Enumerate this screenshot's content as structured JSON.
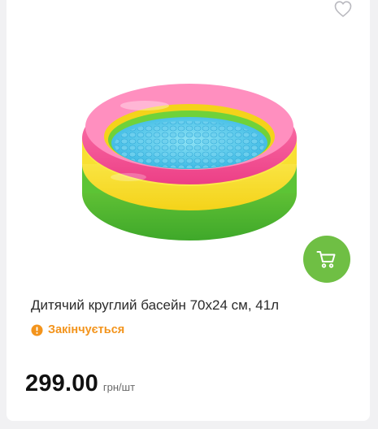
{
  "product": {
    "title": "Дитячий круглий басейн 70х24 см, 41л",
    "stock_status": "Закінчується",
    "price": "299.00",
    "price_unit": "грн/шт"
  },
  "icons": {
    "favorite": "heart-outline-icon",
    "cart": "shopping-cart-icon",
    "stock": "exclamation-circle-icon"
  },
  "colors": {
    "cart_button": "#6fbf44",
    "stock_warning": "#f3941c",
    "price_text": "#111111"
  }
}
